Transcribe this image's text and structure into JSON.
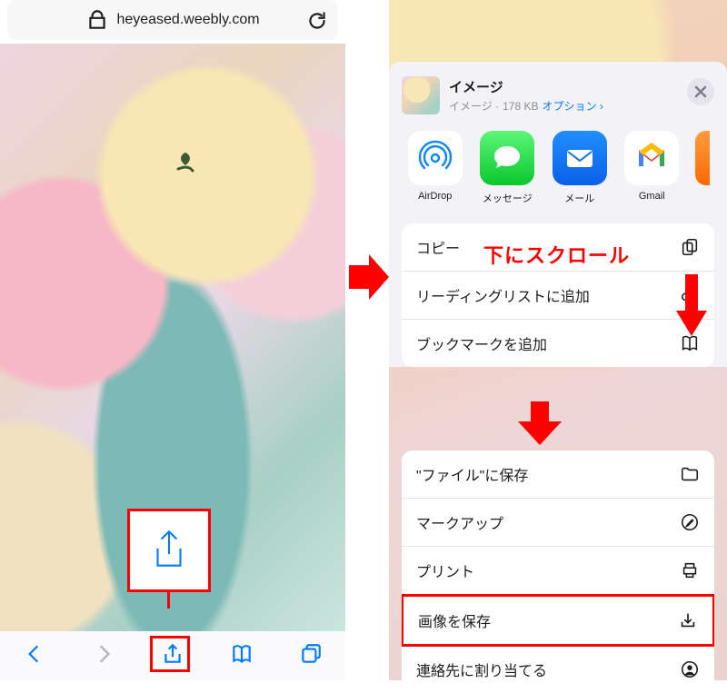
{
  "browser": {
    "url": "heyeased.weebly.com"
  },
  "sheet": {
    "title": "イメージ",
    "subtitle_prefix": "イメージ · ",
    "filesize": "178 KB",
    "options_label": "オプション"
  },
  "apps": [
    {
      "name": "AirDrop"
    },
    {
      "name": "メッセージ"
    },
    {
      "name": "メール"
    },
    {
      "name": "Gmail"
    }
  ],
  "actions1": [
    {
      "label": "コピー",
      "icon": "copy-icon"
    },
    {
      "label": "リーディングリストに追加",
      "icon": "glasses-icon"
    },
    {
      "label": "ブックマークを追加",
      "icon": "book-icon"
    }
  ],
  "actions2": [
    {
      "label": "\"ファイル\"に保存",
      "icon": "folder-icon"
    },
    {
      "label": "マークアップ",
      "icon": "markup-icon"
    },
    {
      "label": "プリント",
      "icon": "print-icon"
    },
    {
      "label": "画像を保存",
      "icon": "download-icon"
    },
    {
      "label": "連絡先に割り当てる",
      "icon": "contact-icon"
    }
  ],
  "annotations": {
    "scroll_down": "下にスクロール"
  }
}
